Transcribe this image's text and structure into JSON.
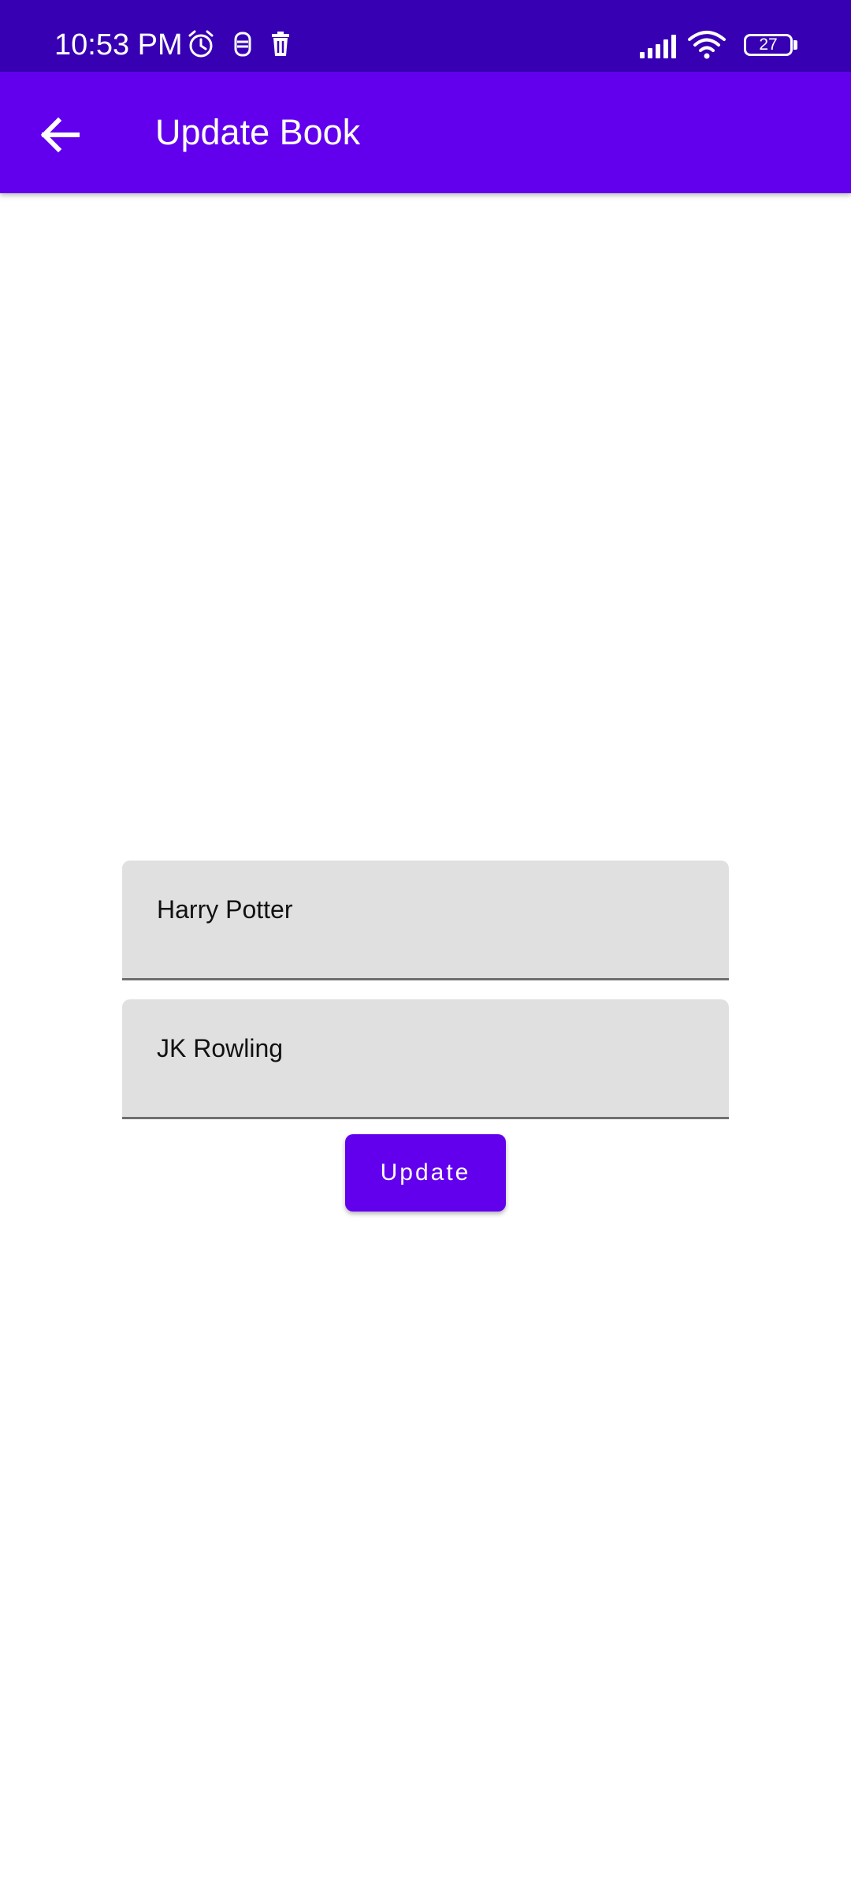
{
  "status_bar": {
    "time": "10:53 PM",
    "battery_level": "27",
    "icons": [
      "alarm-icon",
      "notification-icon",
      "trash-icon",
      "signal-icon",
      "wifi-icon",
      "battery-icon"
    ]
  },
  "app_bar": {
    "title": "Update Book",
    "back_icon": "arrow-back-icon"
  },
  "form": {
    "book_name_value": "Harry Potter",
    "author_value": "JK Rowling",
    "update_label": "Update"
  },
  "colors": {
    "status_bar": "#3700B3",
    "primary": "#6200EE",
    "field_background": "#E0E0E0"
  }
}
